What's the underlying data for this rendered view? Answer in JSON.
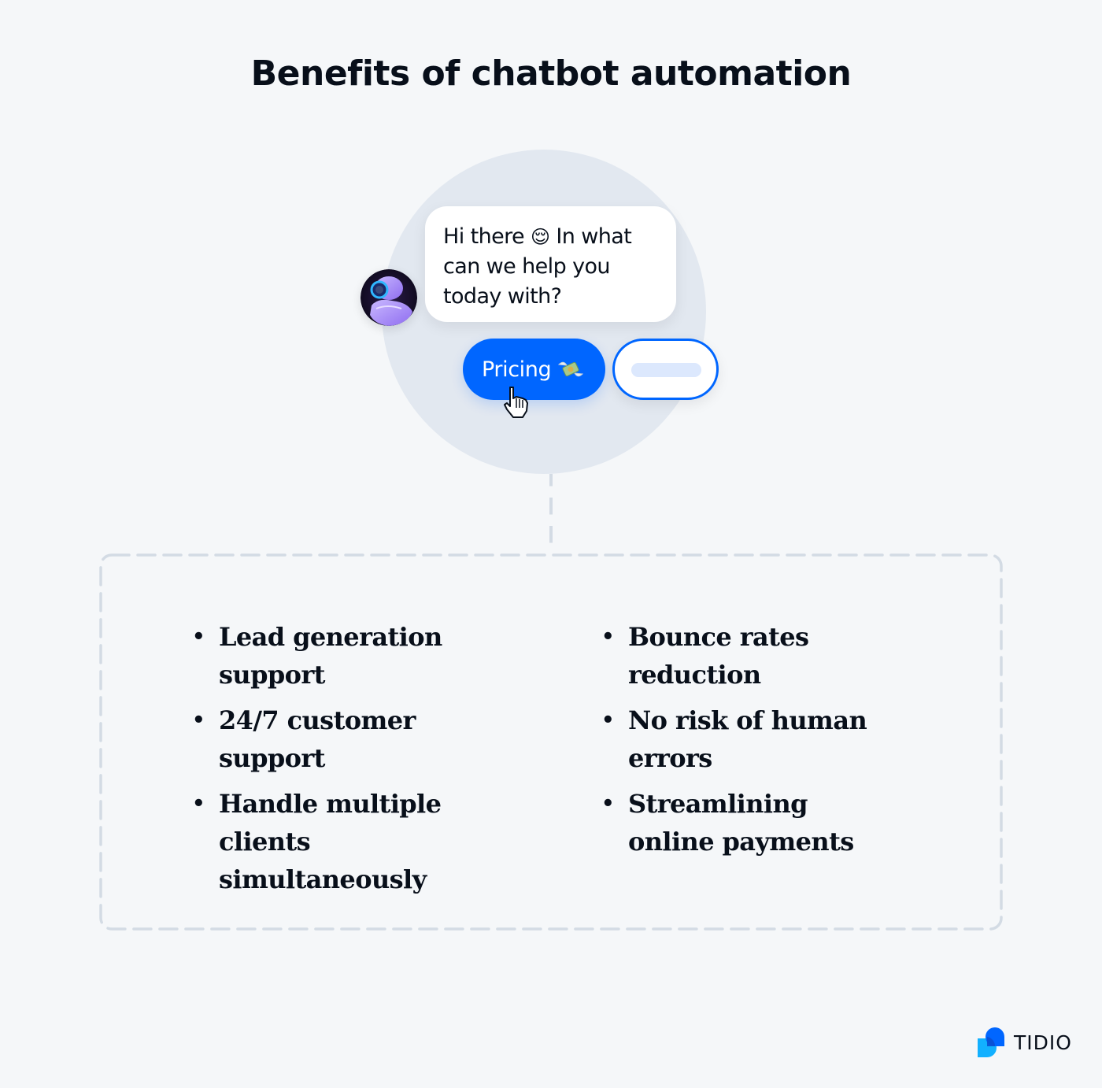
{
  "title": "Benefits of chatbot automation",
  "chat": {
    "avatar_icon": "robot-avatar-icon",
    "message_line_1": "Hi there",
    "message_emoji": "😌",
    "message_line_1_rest": " In what",
    "message_line_2": "can we help you",
    "message_line_3": "today with?",
    "quick_reply_primary": {
      "label": "Pricing",
      "emoji_icon": "money-with-wings-icon"
    },
    "quick_reply_secondary": {
      "label": ""
    },
    "cursor_icon": "pointer-hand-cursor-icon"
  },
  "benefits": {
    "left": [
      "Lead generation support",
      "24/7 customer support",
      "Handle multiple clients simultaneously"
    ],
    "right": [
      "Bounce rates reduction",
      "No risk of human errors",
      "Streamlining online payments"
    ],
    "bullet": "•"
  },
  "brand": {
    "name": "TIDIO",
    "colors": {
      "primary_blue": "#0066ff",
      "light_blue": "#12b0ff",
      "text": "#080f1a",
      "background": "#f5f7f9",
      "circle": "#e2e8f0",
      "dashed_border": "#d3dbe4"
    }
  }
}
